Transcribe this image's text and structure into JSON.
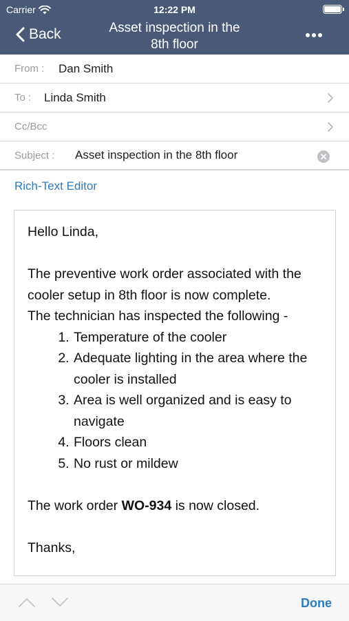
{
  "status_bar": {
    "carrier": "Carrier",
    "time": "12:22 PM"
  },
  "nav": {
    "back_label": "Back",
    "title_line1": "Asset inspection in the",
    "title_line2": "8th floor"
  },
  "form": {
    "from_label": "From :",
    "from_value": "Dan Smith",
    "to_label": "To :",
    "to_value": "Linda Smith",
    "ccbcc_label": "Cc/Bcc",
    "subject_label": "Subject :",
    "subject_value": "Asset inspection in the 8th floor"
  },
  "rich_text_editor_label": "Rich-Text Editor",
  "body": {
    "greeting": "Hello Linda,",
    "para1": "The preventive work order associated with the cooler setup in 8th floor is now complete.",
    "intro": "The technician has inspected the following -",
    "items": [
      "Temperature of the cooler",
      "Adequate lighting in the area where the cooler is installed",
      "Area is well organized and is easy to navigate",
      "Floors clean",
      "No rust or mildew"
    ],
    "closing_prefix": "The work order ",
    "closing_wo": "WO-934",
    "closing_suffix": " is now closed.",
    "signoff": "Thanks,"
  },
  "toolbar": {
    "done_label": "Done"
  },
  "colors": {
    "nav_bg": "#4a5978",
    "link": "#2b7cc1",
    "separator": "#d7d7d9"
  },
  "icons": [
    "wifi-icon",
    "battery-icon",
    "back-chevron-icon",
    "more-icon",
    "chevron-right-icon",
    "clear-icon",
    "arrow-up-icon",
    "arrow-down-icon"
  ]
}
